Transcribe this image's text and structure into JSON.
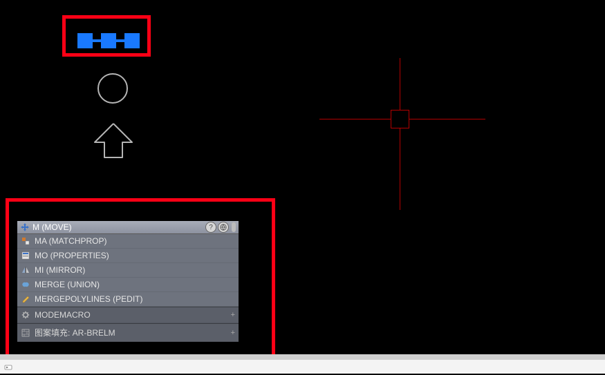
{
  "colors": {
    "highlight": "#ff0015",
    "grip": "#1979ff",
    "crosshair": "#b30000",
    "outline": "#b5b5b5"
  },
  "autocomplete": {
    "active": "M (MOVE)",
    "help_icon_label": "?",
    "items": [
      {
        "icon": "matchprop-icon",
        "label": "MA (MATCHPROP)"
      },
      {
        "icon": "properties-icon",
        "label": "MO (PROPERTIES)"
      },
      {
        "icon": "mirror-icon",
        "label": "MI (MIRROR)"
      },
      {
        "icon": "union-icon",
        "label": "MERGE (UNION)"
      },
      {
        "icon": "pedit-icon",
        "label": "MERGEPOLYLINES (PEDIT)"
      }
    ],
    "footer": [
      {
        "icon": "gear-icon",
        "label": "MODEMACRO"
      },
      {
        "icon": "hatch-icon",
        "label": "图案填充: AR-BRELM"
      }
    ]
  }
}
